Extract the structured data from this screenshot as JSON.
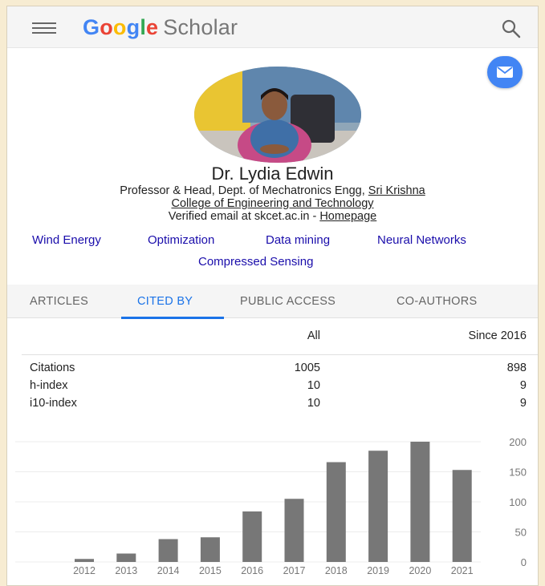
{
  "header": {
    "logo_letters": [
      "G",
      "o",
      "o",
      "g",
      "l",
      "e"
    ],
    "logo_suffix": "Scholar"
  },
  "profile": {
    "name": "Dr. Lydia Edwin",
    "affiliation_prefix": "Professor & Head, Dept. of Mechatronics Engg, ",
    "affiliation_link_part1": "Sri Krishna",
    "affiliation_link_part2": "College of Engineering and Technology",
    "email_text": "Verified email at skcet.ac.in - ",
    "homepage_label": "Homepage"
  },
  "interests": [
    "Wind Energy",
    "Optimization",
    "Data mining",
    "Neural Networks",
    "Compressed Sensing"
  ],
  "tabs": [
    "ARTICLES",
    "CITED BY",
    "PUBLIC ACCESS",
    "CO-AUTHORS"
  ],
  "stats": {
    "col_all": "All",
    "col_since": "Since 2016",
    "rows": [
      {
        "label": "Citations",
        "all": "1005",
        "since": "898"
      },
      {
        "label": "h-index",
        "all": "10",
        "since": "9"
      },
      {
        "label": "i10-index",
        "all": "10",
        "since": "9"
      }
    ]
  },
  "colors": {
    "accent": "#1a73e8",
    "link": "#1a0dab",
    "bar": "#777777"
  },
  "chart_data": {
    "type": "bar",
    "categories": [
      "2012",
      "2013",
      "2014",
      "2015",
      "2016",
      "2017",
      "2018",
      "2019",
      "2020",
      "2021"
    ],
    "values": [
      5,
      14,
      38,
      41,
      84,
      105,
      166,
      185,
      200,
      153
    ],
    "yticks": [
      0,
      50,
      100,
      150,
      200
    ],
    "ylim": [
      0,
      200
    ],
    "grid": true
  }
}
